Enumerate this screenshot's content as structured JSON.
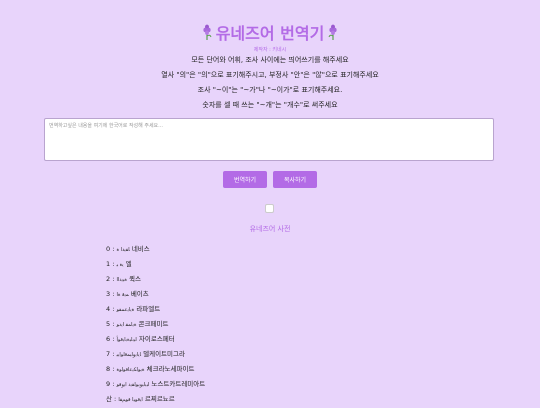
{
  "header": {
    "title": "유네즈어 번역기",
    "subtitle": "제작자 : 키네시"
  },
  "instructions": [
    "모든 단어와 어휘, 조사 사이에는 띄어쓰기를 해주세요",
    "열사 \"의\"은 \"의\"으로 표기해주시고, 부정사 \"안\"은 \"않\"으로 표기해주세요",
    "조사 \"~이\"는 \"~가\"나 \"~이가\"로 표기해주세요.",
    "숫자를 셀 때 쓰는 \"~개\"는 \"개수\"로 써주세요"
  ],
  "input": {
    "placeholder": "번역하고싶은 내용을 여기에 한국어로 작성해 주세요..."
  },
  "buttons": {
    "translate": "번역하기",
    "copy": "복사하기"
  },
  "dictionary": {
    "title": "유네즈어 사전",
    "items": [
      {
        "num": "0",
        "sym": "ﺎﻘﯾﺩﺍ ﺓ",
        "word": "네비스"
      },
      {
        "num": "1",
        "sym": "ﯾﺓ ﯿ",
        "word": "엘"
      },
      {
        "num": "2",
        "sym": "ﺓﯿﯾﺩﺍﺍ",
        "word": "퀵스"
      },
      {
        "num": "3",
        "sym": "ﻤﯾﻗ ﺓﺍ",
        "word": "베이츠"
      },
      {
        "num": "4",
        "sym": "ﺓﯾﺍﯾﻋﻤﻘﻮ",
        "word": "라파엘트"
      },
      {
        "num": "5",
        "sym": "ﺓﯾﺍﻤﻘ ﺍﯾﺩﻮ",
        "word": "콘크페미트"
      },
      {
        "num": "6",
        "sym": "ﺍﯿﺑﺍﯿﺓﺑﺍﯾﻗﻮﺃ",
        "word": "자이로스페터"
      },
      {
        "num": "7",
        "sym": "ﺎﯾﺍﯾﻭﺍﯿﻤﻗﺍﻮﺍﯾﯿ",
        "word": "델케이트미그라"
      },
      {
        "num": "8",
        "sym": "ﺓﯾﻮﺍﻜﯾﻋﺍﻗﻮﺍﻮﺓ",
        "word": "체크라노세파이트"
      },
      {
        "num": "9",
        "sym": "ﺍﯿﺑﺍﯿﻭﯾﻮﺍﻘﯾﺩ ﺍﯾﻭﻗﻮ",
        "word": "노스트카트레미아트"
      },
      {
        "num": "산",
        "sym": "ﺍﯾﻗﻮﯿﺍ ﻗﻮﻢﻘﺍ",
        "word": "르찌르뇨르"
      }
    ]
  },
  "colors": {
    "background": "#e8d4fb",
    "accent": "#b36be6"
  }
}
